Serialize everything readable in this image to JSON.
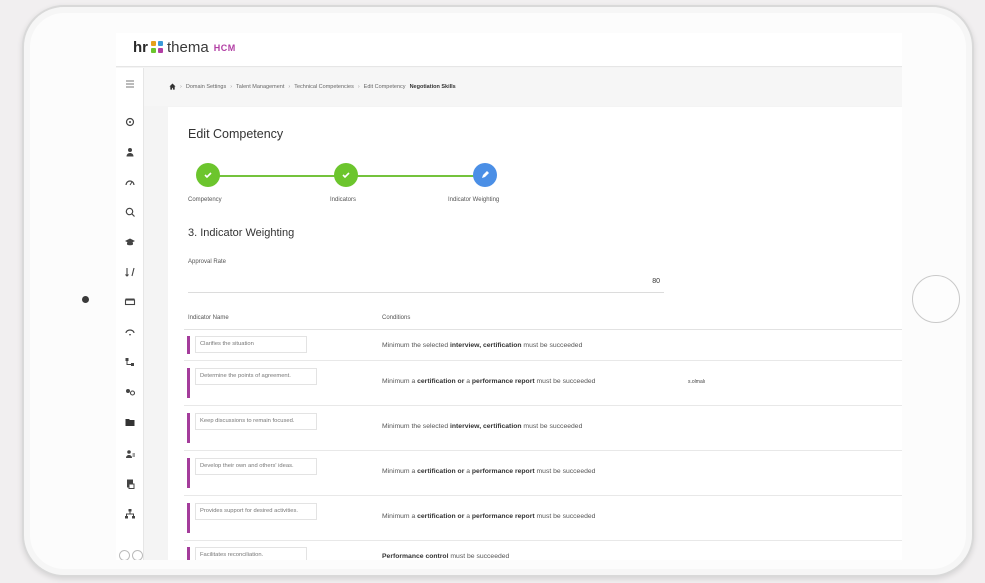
{
  "app": {
    "logo_hr": "hr",
    "logo_thema": "thema",
    "logo_hcm": "HCM"
  },
  "breadcrumb": {
    "items": [
      "Domain Settings",
      "Talent Management",
      "Technical Competencies",
      "Edit Competency"
    ],
    "current": "Negotiation Skills"
  },
  "page": {
    "title": "Edit Competency",
    "section_title": "3. Indicator Weighting"
  },
  "stepper": {
    "steps": [
      {
        "label": "Competency",
        "status": "done"
      },
      {
        "label": "Indicators",
        "status": "done"
      },
      {
        "label": "Indicator Weighting",
        "status": "active"
      }
    ]
  },
  "approval": {
    "label": "Approval Rate",
    "value": "80"
  },
  "table": {
    "headers": [
      "Indicator Name",
      "Conditions"
    ],
    "rows": [
      {
        "name": "Clarifies the situation",
        "cond_pre": "Minimum the selected ",
        "cond_bold": "interview, certification",
        "cond_mid": "",
        "cond_bold2": "",
        "cond_post": " must be succeeded",
        "extra": ""
      },
      {
        "name": "Determine the points of agreement.",
        "cond_pre": "Minimum a ",
        "cond_bold": "certification or",
        "cond_mid": " a ",
        "cond_bold2": "performance report",
        "cond_post": " must be succeeded",
        "extra": "s.olmalı"
      },
      {
        "name": "Keep discussions to remain focused.",
        "cond_pre": "Minimum the selected ",
        "cond_bold": "interview, certification",
        "cond_mid": "",
        "cond_bold2": "",
        "cond_post": " must be succeeded",
        "extra": ""
      },
      {
        "name": "Develop their own and others' ideas.",
        "cond_pre": "Minimum a ",
        "cond_bold": "certification or",
        "cond_mid": " a ",
        "cond_bold2": "performance report",
        "cond_post": " must be succeeded",
        "extra": ""
      },
      {
        "name": "Provides support for desired activities.",
        "cond_pre": "Minimum a ",
        "cond_bold": "certification or",
        "cond_mid": " a ",
        "cond_bold2": "performance report",
        "cond_post": " must be succeeded",
        "extra": ""
      },
      {
        "name": "Facilitates reconciliation.",
        "cond_pre": "",
        "cond_bold": "Performance control",
        "cond_mid": "",
        "cond_bold2": "",
        "cond_post": " must be succeeded",
        "extra": ""
      }
    ]
  },
  "sidebar": {
    "icons": [
      "menu-icon",
      "dashboard-icon",
      "person-icon",
      "speedometer-icon",
      "search-people-icon",
      "education-icon",
      "sort-icon",
      "money-icon",
      "feedback-icon",
      "org-chart-icon",
      "settings-people-icon",
      "folder-icon",
      "user-group-icon",
      "document-icon",
      "hierarchy-icon"
    ]
  },
  "colors": {
    "step_done": "#6cc52d",
    "step_active": "#4b8fe6",
    "accent_bar": "#a43c9b",
    "brand_hcm": "#b23ea4"
  }
}
